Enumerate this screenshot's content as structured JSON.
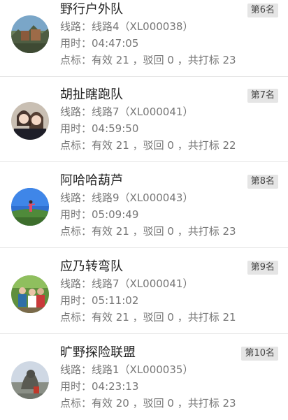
{
  "teams": [
    {
      "name": "野行户外队",
      "rank": "第6名",
      "route_line": "线路：线路4（XL000038）",
      "time_line": "用时：04:47:05",
      "points_line": "点标：有效 21 ，驳回 0 ，共打标 23",
      "avatar_icon": "landscape-photo-avatar"
    },
    {
      "name": "胡扯瞎跑队",
      "rank": "第7名",
      "route_line": "线路：线路7（XL000041）",
      "time_line": "用时：04:59:50",
      "points_line": "点标：有效 21 ，驳回 0 ，共打标 22",
      "avatar_icon": "two-women-selfie-avatar"
    },
    {
      "name": "阿哈哈葫芦",
      "rank": "第8名",
      "route_line": "线路：线路9（XL000043）",
      "time_line": "用时：05:09:49",
      "points_line": "点标：有效 21 ，驳回 0 ，共打标 23",
      "avatar_icon": "person-on-field-avatar"
    },
    {
      "name": "应乃转弯队",
      "rank": "第9名",
      "route_line": "线路：线路7（XL000041）",
      "time_line": "用时：05:11:02",
      "points_line": "点标：有效 21 ，驳回 0 ，共打标 21",
      "avatar_icon": "group-photo-avatar"
    },
    {
      "name": "旷野探险联盟",
      "rank": "第10名",
      "route_line": "线路：线路1（XL000035）",
      "time_line": "用时：04:23:13",
      "points_line": "点标：有效 20 ，驳回 0 ，共打标 23",
      "avatar_icon": "statue-sky-avatar"
    }
  ],
  "colors": {
    "divider": "#e6e6e6",
    "badge_bg": "#e5e5e5",
    "title": "#222222",
    "meta": "#777777"
  }
}
